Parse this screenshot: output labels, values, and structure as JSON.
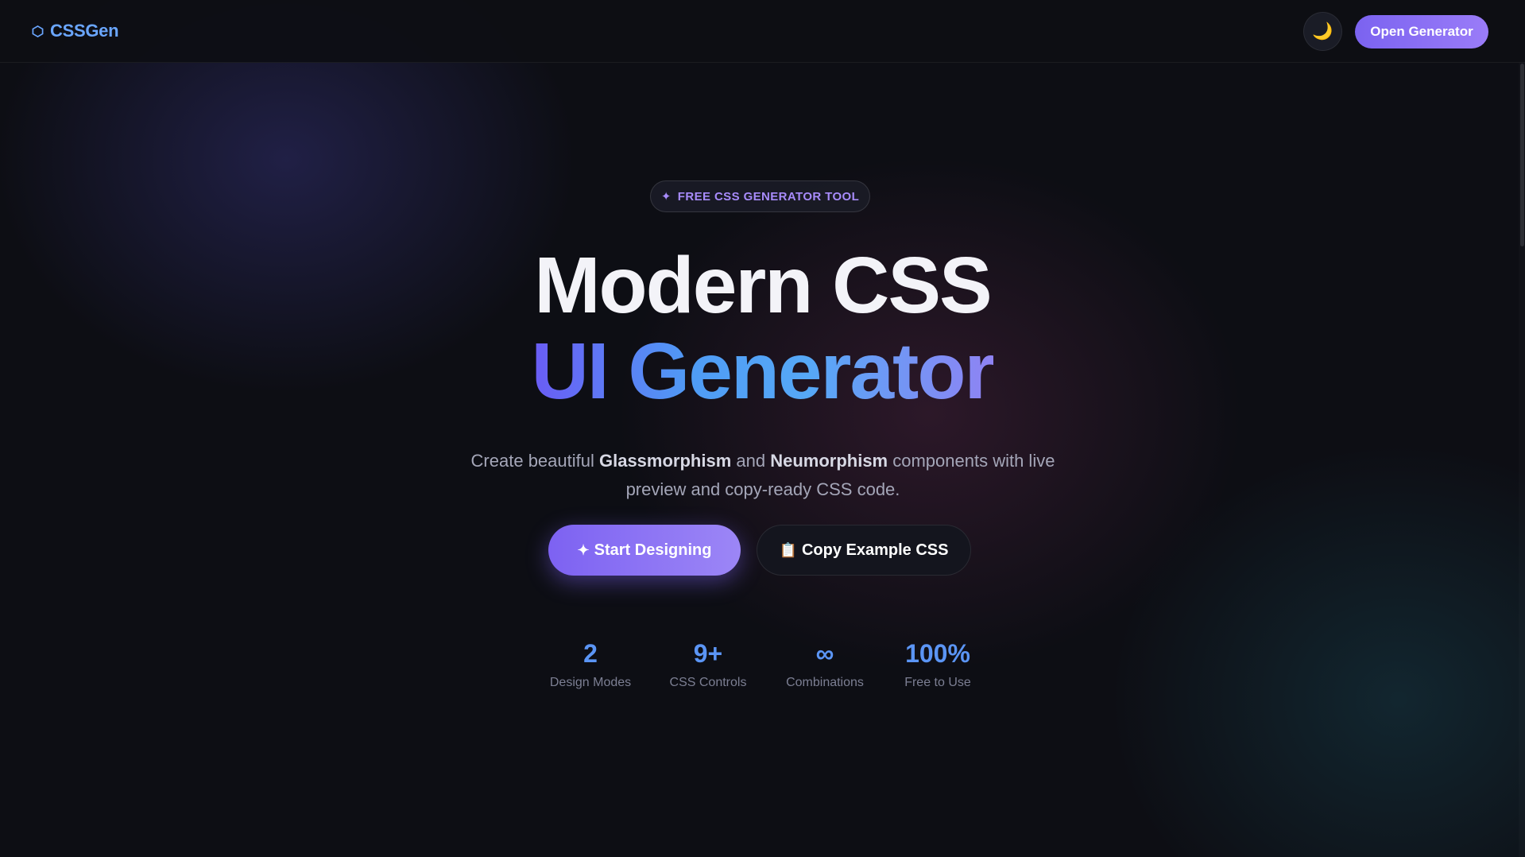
{
  "header": {
    "logo_text": "CSSGen",
    "logo_icon": "hexagon-icon",
    "theme_toggle_icon": "moon-icon",
    "theme_toggle_glyph": "🌙",
    "open_button_label": "Open Generator"
  },
  "hero": {
    "badge_icon_glyph": "✦",
    "badge_text": "FREE CSS GENERATOR TOOL",
    "title_line1": "Modern CSS",
    "title_line2": "UI Generator",
    "subtitle": {
      "part1": "Create beautiful ",
      "bold1": "Glassmorphism",
      "part2": " and ",
      "bold2": "Neumorphism",
      "part3": " components with live preview and copy-ready CSS code."
    },
    "primary_cta": {
      "icon": "sparkle-icon",
      "icon_glyph": "✦",
      "label": "Start Designing"
    },
    "secondary_cta": {
      "icon": "clipboard-icon",
      "icon_glyph": "📋",
      "label": "Copy Example CSS"
    }
  },
  "stats": [
    {
      "value": "2",
      "label": "Design Modes"
    },
    {
      "value": "9+",
      "label": "CSS Controls"
    },
    {
      "value": "∞",
      "label": "Combinations"
    },
    {
      "value": "100%",
      "label": "Free to Use"
    }
  ],
  "colors": {
    "accent_purple": "#7b63f0",
    "accent_blue": "#5b95f5",
    "background": "#0d0e14",
    "badge_text": "#a78bfa"
  }
}
